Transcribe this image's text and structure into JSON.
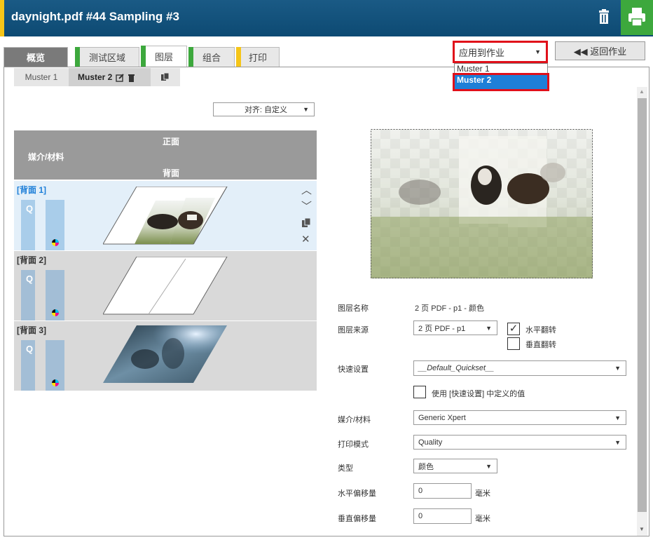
{
  "header": {
    "title": "daynight.pdf #44 Sampling #3"
  },
  "tabs": [
    {
      "label": "概览",
      "strip": ""
    },
    {
      "label": "测试区域",
      "strip": "#3da83d"
    },
    {
      "label": "图层",
      "strip": "#3da83d"
    },
    {
      "label": "组合",
      "strip": "#3da83d"
    },
    {
      "label": "打印",
      "strip": "#f5c518"
    }
  ],
  "apply": {
    "selected": "应用到作业",
    "options": [
      "Muster 1",
      "Muster 2"
    ],
    "return_label": "◀◀ 返回作业"
  },
  "subtabs": {
    "muster1": "Muster 1",
    "muster2": "Muster 2"
  },
  "align": {
    "value": "对齐: 自定义"
  },
  "table": {
    "front": "正面",
    "media": "媒介/材料",
    "back": "背面",
    "rows": [
      {
        "label": "[背面 1]",
        "q": "Q"
      },
      {
        "label": "[背面 2]",
        "q": "Q"
      },
      {
        "label": "[背面 3]",
        "q": "Q"
      }
    ]
  },
  "form": {
    "layer_name_label": "图层名称",
    "layer_name_value": "2 页 PDF - p1 - 颜色",
    "layer_source_label": "图层来源",
    "layer_source_value": "2 页 PDF - p1",
    "flip_h": "水平翻转",
    "flip_v": "垂直翻转",
    "quickset_label": "快速设置",
    "quickset_value": "__Default_Quickset__",
    "use_quickset": "使用 [快速设置] 中定义的值",
    "media_label": "媒介/材料",
    "media_value": "Generic Xpert",
    "print_mode_label": "打印模式",
    "print_mode_value": "Quality",
    "type_label": "类型",
    "type_value": "颜色",
    "h_offset_label": "水平偏移量",
    "h_offset_value": "0",
    "v_offset_label": "垂直偏移量",
    "v_offset_value": "0",
    "unit": "毫米"
  },
  "colors": {
    "header": "#0d4a73",
    "highlight": "#e0101a",
    "selected": "#1e7fd8",
    "row_active": "#e3eff9",
    "green": "#3da83d",
    "yellow": "#f5c518"
  }
}
